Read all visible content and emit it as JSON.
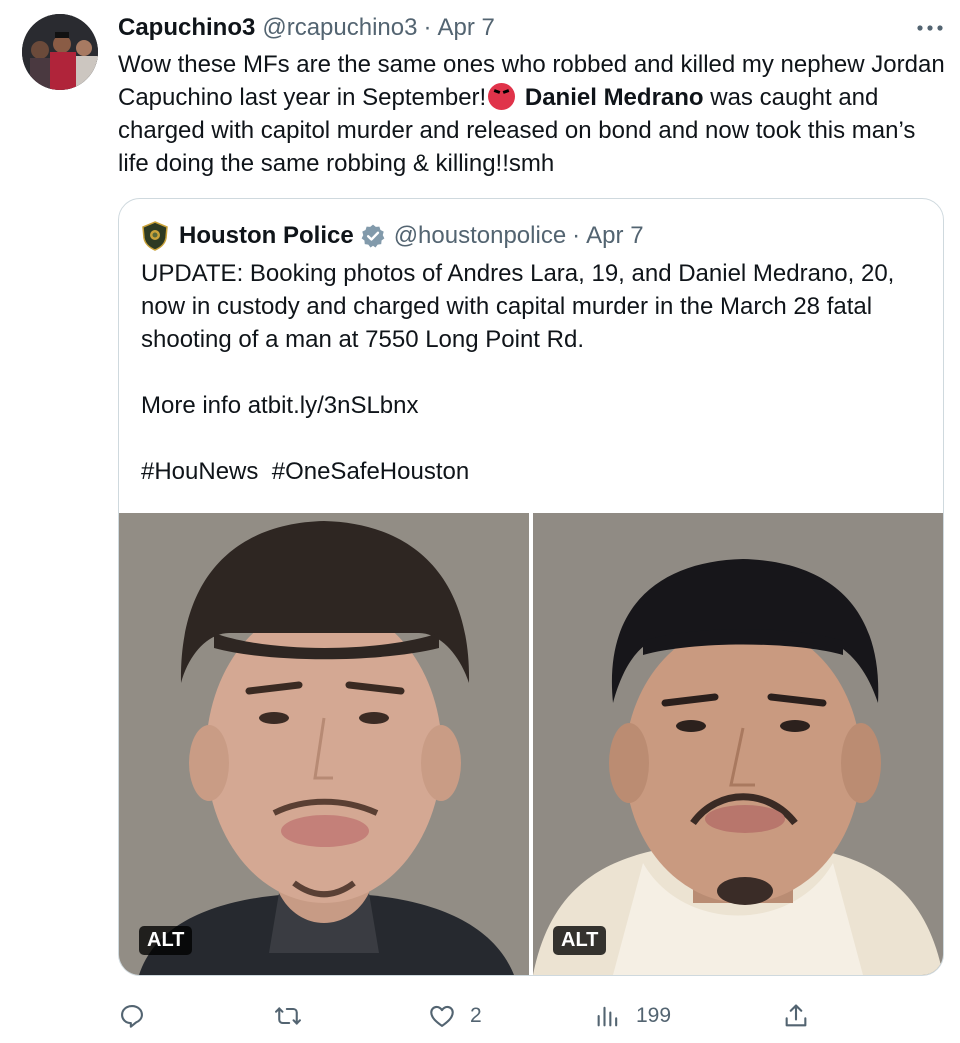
{
  "tweet": {
    "author_name": "Capuchino3",
    "author_handle": "@rcapuchino3",
    "separator": "·",
    "time": "Apr 7",
    "text_part1": "Wow these MFs are the same ones who robbed and killed my nephew Jordan Capuchino last year in September!",
    "text_bold": "Daniel Medrano",
    "text_part2": " was caught and charged with capitol murder and released on bond and now took this man’s life doing the same robbing & killing!!smh"
  },
  "quote": {
    "author_name": "Houston Police",
    "author_handle": "@houstonpolice",
    "separator": "·",
    "time": "Apr 7",
    "text": "UPDATE: Booking photos of Andres Lara, 19, and Daniel Medrano, 20, now in custody and charged with capital murder in the March 28 fatal shooting of a man at 7550 Long Point Rd.\n\nMore info atbit.ly/3nSLbnx\n\n#HouNews  #OneSafeHouston",
    "photos": [
      {
        "alt_label": "ALT"
      },
      {
        "alt_label": "ALT"
      }
    ]
  },
  "actions": {
    "reply_count": "",
    "retweet_count": "",
    "like_count": "2",
    "views_count": "199"
  },
  "colors": {
    "text": "#0f1419",
    "secondary": "#536471",
    "border": "#cfd9de",
    "verified": "#829aab"
  },
  "icons": [
    "more-icon",
    "verified-badge-icon",
    "houston-police-badge-icon",
    "reply-icon",
    "retweet-icon",
    "like-icon",
    "views-icon",
    "share-icon"
  ]
}
